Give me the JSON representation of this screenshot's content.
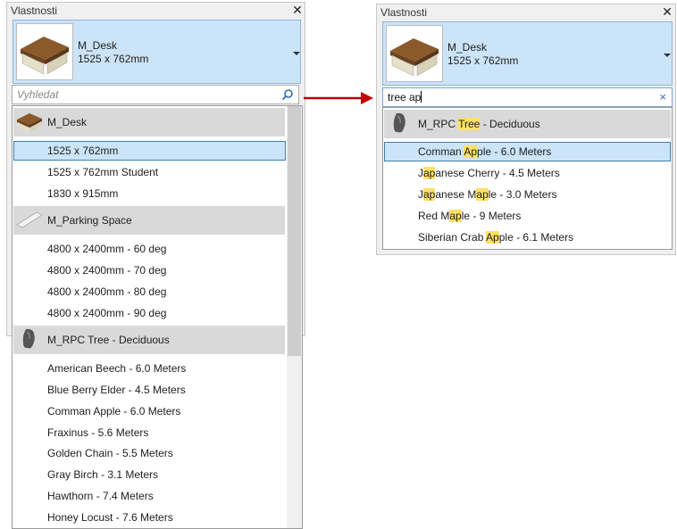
{
  "left": {
    "panel_title": "Vlastnosti",
    "type_name": "M_Desk",
    "type_size": "1525 x 762mm",
    "search_placeholder": "Vyhledat",
    "groups": [
      {
        "label": "M_Desk",
        "items": [
          "1525 x 762mm",
          "1525 x 762mm Student",
          "1830 x 915mm"
        ]
      },
      {
        "label": "M_Parking Space",
        "items": [
          "4800 x 2400mm - 60 deg",
          "4800 x 2400mm - 70 deg",
          "4800 x 2400mm - 80 deg",
          "4800 x 2400mm - 90 deg"
        ]
      },
      {
        "label": "M_RPC Tree - Deciduous",
        "items": [
          "American Beech - 6.0 Meters",
          "Blue Berry Elder - 4.5 Meters",
          "Comman Apple - 6.0 Meters",
          "Fraxinus - 5.6 Meters",
          "Golden Chain - 5.5 Meters",
          "Gray Birch - 3.1 Meters",
          "Hawthorn - 7.4 Meters",
          "Honey Locust - 7.6 Meters"
        ]
      }
    ],
    "selected_item": "1525 x 762mm"
  },
  "right": {
    "panel_title": "Vlastnosti",
    "type_name": "M_Desk",
    "type_size": "1525 x 762mm",
    "search_value": "tree ap",
    "group": {
      "pre": "M_RPC ",
      "hl": "Tree",
      "post": " - Deciduous"
    },
    "items": [
      {
        "pre": "Comman ",
        "hl": "Ap",
        "post": "ple - 6.0 Meters"
      },
      {
        "pre": "J",
        "hl": "ap",
        "post": "anese Cherry - 4.5 Meters"
      },
      {
        "pre": "J",
        "hl": "ap",
        "post": "anese Maple - 3.0 Meters",
        "pre2": "J",
        "hl2": "ap",
        "mid2": "anese M",
        "hl3": "ap",
        "post3": "le - 3.0 Meters"
      },
      {
        "pre": "Red M",
        "hl": "ap",
        "post": "le - 9 Meters"
      },
      {
        "pre": "Siberian Crab ",
        "hl": "Ap",
        "post": "ple - 6.1 Meters"
      }
    ]
  },
  "colors": {
    "accent": "#cce4f7",
    "highlight": "#ffe066",
    "arrow": "#c00000"
  }
}
